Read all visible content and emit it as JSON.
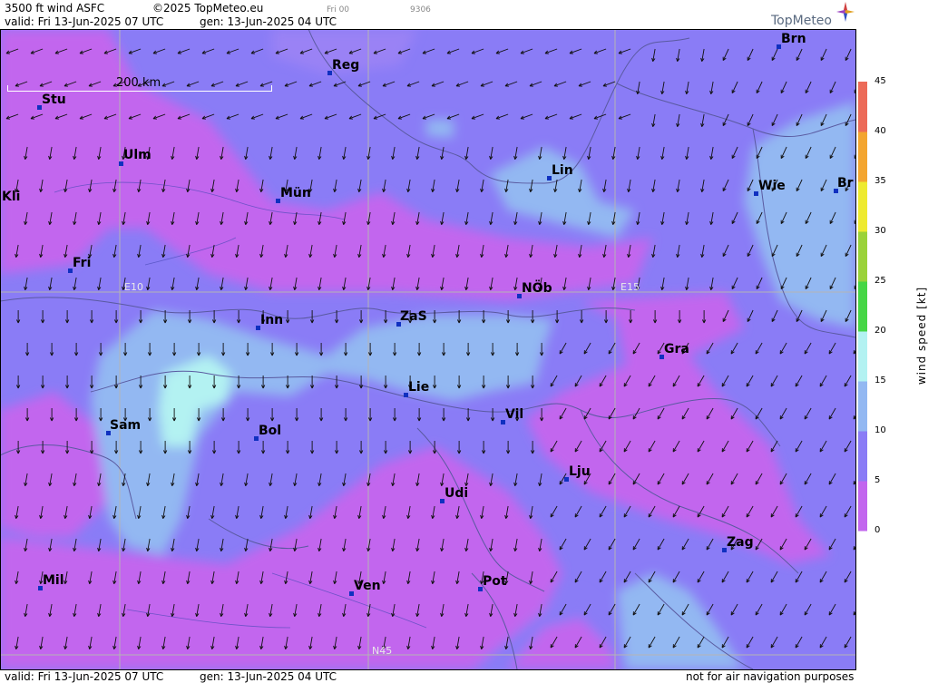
{
  "header": {
    "title": "3500 ft wind ASFC",
    "copyright": "©2025 TopMeteo.eu",
    "run": "Fri 00",
    "code": "9306",
    "valid": "valid:  Fri  13-Jun-2025  07 UTC",
    "gen": "gen: 13-Jun-2025 04 UTC",
    "logo": "TopMeteo"
  },
  "footer": {
    "valid": "valid:  Fri  13-Jun-2025  07 UTC",
    "gen": "gen: 13-Jun-2025 04 UTC",
    "disclaimer": "not for air navigation purposes"
  },
  "scale": {
    "label": "200 km"
  },
  "grid_labels": {
    "e10": "E10",
    "e15": "E15",
    "n45": "N45"
  },
  "cities": [
    {
      "name": "Stu"
    },
    {
      "name": "Reg"
    },
    {
      "name": "Brn"
    },
    {
      "name": "Ulm"
    },
    {
      "name": "Lin"
    },
    {
      "name": "Kli"
    },
    {
      "name": "Mün"
    },
    {
      "name": "Wie"
    },
    {
      "name": "Br"
    },
    {
      "name": "Fri"
    },
    {
      "name": "NÖb"
    },
    {
      "name": "Inn"
    },
    {
      "name": "ZaS"
    },
    {
      "name": "Gra"
    },
    {
      "name": "Lie"
    },
    {
      "name": "Vil"
    },
    {
      "name": "Sam"
    },
    {
      "name": "Bol"
    },
    {
      "name": "Lju"
    },
    {
      "name": "Udi"
    },
    {
      "name": "Zag"
    },
    {
      "name": "Mil"
    },
    {
      "name": "Ven"
    },
    {
      "name": "Pot"
    }
  ],
  "legend": {
    "label": "wind  speed  [kt]",
    "unit": "kt",
    "ticks": [
      "45",
      "40",
      "35",
      "30",
      "25",
      "20",
      "15",
      "10",
      "5",
      "0"
    ],
    "colors": [
      "#c266ee",
      "#8a7cf6",
      "#93b8f2",
      "#b3f2f2",
      "#46d646",
      "#9ad23a",
      "#eeea30",
      "#f3a530",
      "#ec6a58"
    ]
  }
}
